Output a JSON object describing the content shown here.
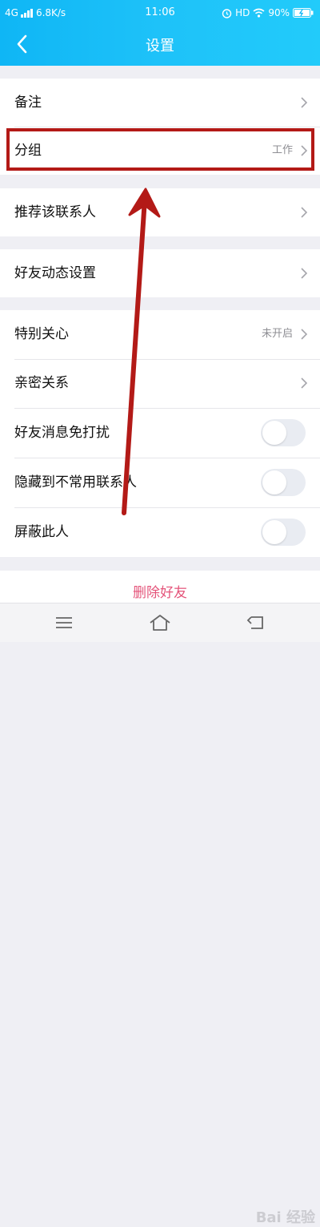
{
  "status": {
    "network": "4G",
    "speed": "6.8K/s",
    "time": "11:06",
    "hd": "HD",
    "battery": "90%"
  },
  "header": {
    "title": "设置"
  },
  "rows": [
    {
      "label": "备注",
      "value": "",
      "control": "chevron"
    },
    {
      "label": "分组",
      "value": "工作",
      "control": "chevron"
    },
    {
      "label": "推荐该联系人",
      "value": "",
      "control": "chevron"
    },
    {
      "label": "好友动态设置",
      "value": "",
      "control": "chevron"
    },
    {
      "label": "特别关心",
      "value": "未开启",
      "control": "chevron"
    },
    {
      "label": "亲密关系",
      "value": "",
      "control": "chevron"
    },
    {
      "label": "好友消息免打扰",
      "value": "",
      "control": "toggle",
      "on": false
    },
    {
      "label": "隐藏到不常用联系人",
      "value": "",
      "control": "toggle",
      "on": false
    },
    {
      "label": "屏蔽此人",
      "value": "",
      "control": "toggle",
      "on": false
    }
  ],
  "delete_label": "删除好友",
  "bottom_nav": [
    "menu-icon",
    "home-icon",
    "back-icon"
  ],
  "watermark": "Bai 经验",
  "colors": {
    "header": "#1ec2f9",
    "highlight": "#b31a17",
    "delete": "#e4547a"
  }
}
